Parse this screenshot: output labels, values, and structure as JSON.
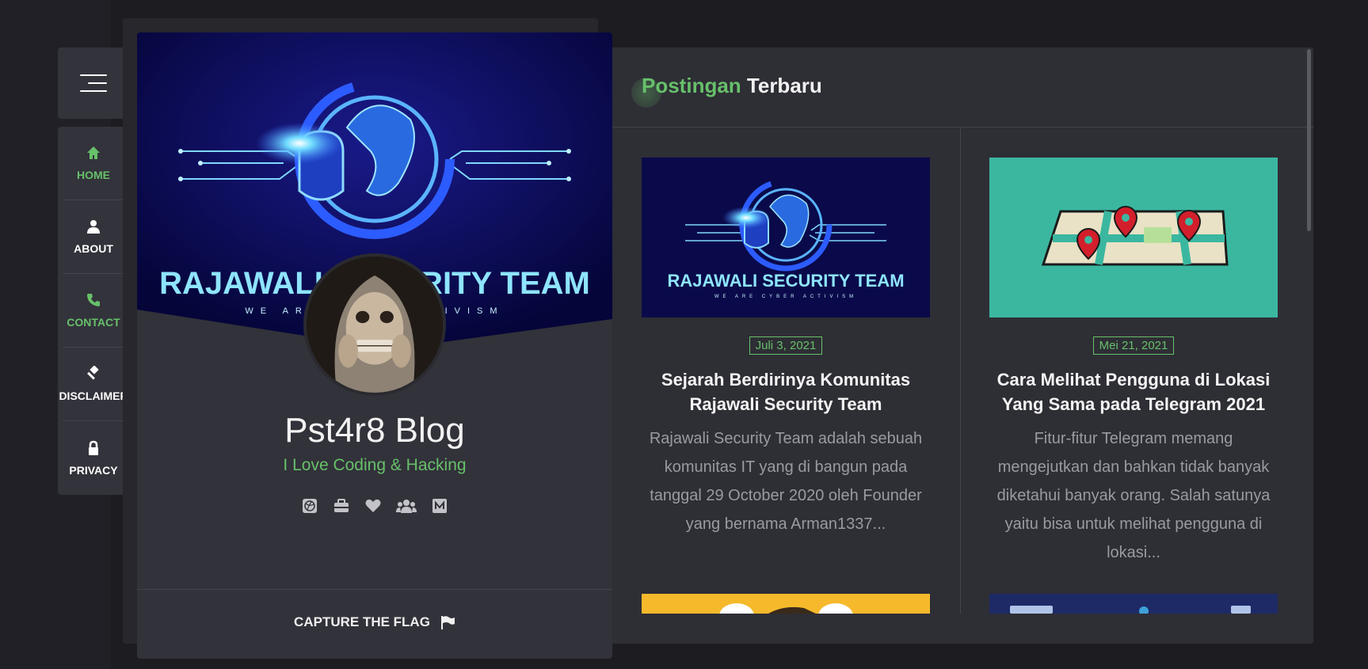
{
  "nav": {
    "items": [
      {
        "label": "HOME",
        "icon": "home-icon"
      },
      {
        "label": "ABOUT",
        "icon": "user-icon"
      },
      {
        "label": "CONTACT",
        "icon": "phone-icon"
      },
      {
        "label": "DISCLAIMER",
        "icon": "gavel-icon"
      },
      {
        "label": "PRIVACY",
        "icon": "lock-icon"
      }
    ]
  },
  "profile": {
    "banner_text": "RAJAWALI SECURITY TEAM",
    "banner_subtext": "WE ARE CYBER ACTIVISM",
    "title": "Pst4r8 Blog",
    "tagline": "I Love Coding & Hacking",
    "social_icons": [
      "dribbble-icon",
      "toolbox-icon",
      "heart-icon",
      "users-icon",
      "medium-icon"
    ],
    "footer_link": "CAPTURE THE FLAG"
  },
  "section": {
    "title_green": "Postingan",
    "title_white": "Terbaru"
  },
  "posts": [
    {
      "date": "Juli 3, 2021",
      "title": "Sejarah Berdirinya Komunitas Rajawali Security Team",
      "excerpt": "Rajawali Security Team adalah sebuah komunitas IT yang di bangun pada tanggal 29 October 2020 oleh Founder yang bernama Arman1337...",
      "thumb_text": "RAJAWALI SECURITY TEAM",
      "thumb_subtext": "WE ARE CYBER ACTIVISM"
    },
    {
      "date": "Mei 21, 2021",
      "title": "Cara Melihat Pengguna di Lokasi Yang Sama pada Telegram 2021",
      "excerpt": "Fitur-fitur Telegram memang mengejutkan dan bahkan tidak banyak diketahui banyak orang. Salah satunya yaitu bisa untuk melihat pengguna di lokasi..."
    }
  ],
  "colors": {
    "accent": "#67c06a",
    "background": "#1c1c21",
    "panel": "#2e2e35",
    "card": "#32323a"
  }
}
